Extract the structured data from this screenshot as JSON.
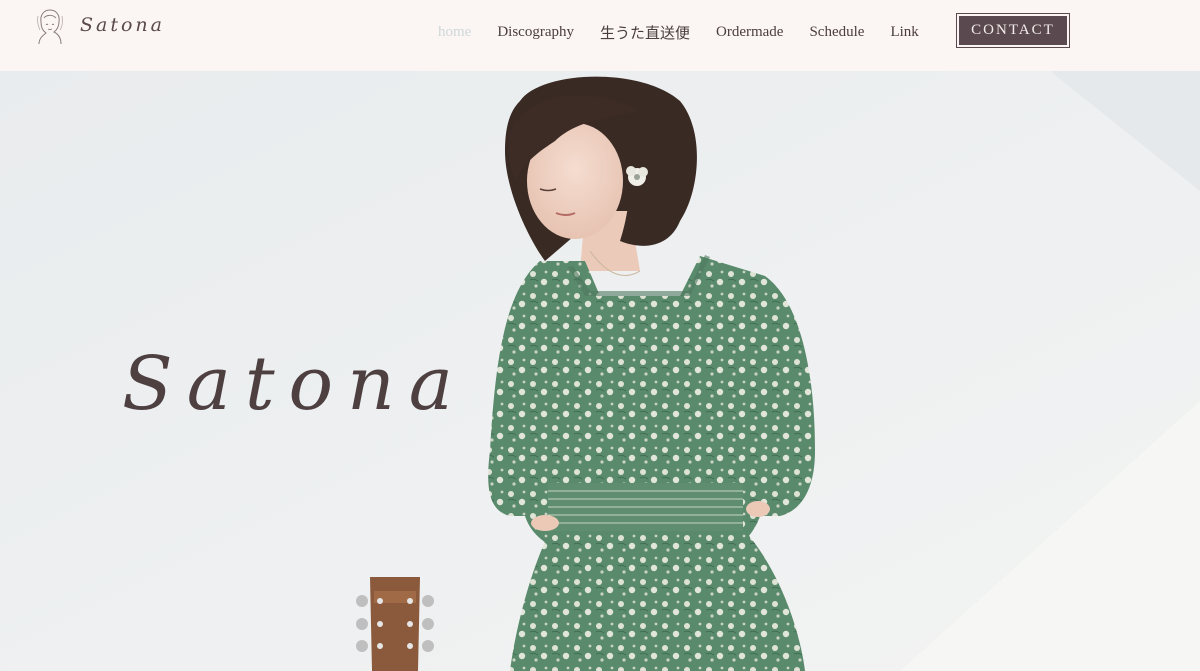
{
  "brand": {
    "logo_text": "Satona",
    "logo_icon": "girl-sketch-icon"
  },
  "nav": {
    "items": [
      {
        "label": "home",
        "active": true
      },
      {
        "label": "Discography",
        "active": false
      },
      {
        "label": "生うた直送便",
        "active": false
      },
      {
        "label": "Ordermade",
        "active": false
      },
      {
        "label": "Schedule",
        "active": false
      },
      {
        "label": "Link",
        "active": false
      }
    ],
    "contact_label": "CONTACT"
  },
  "hero": {
    "title": "Satona"
  },
  "colors": {
    "header_bg": "#fbf6f4",
    "text_brown": "#4a3d3d",
    "active_nav": "#cfd8d8",
    "button_bg": "#5a4a4f",
    "dress_green": "#5a8a6c"
  }
}
